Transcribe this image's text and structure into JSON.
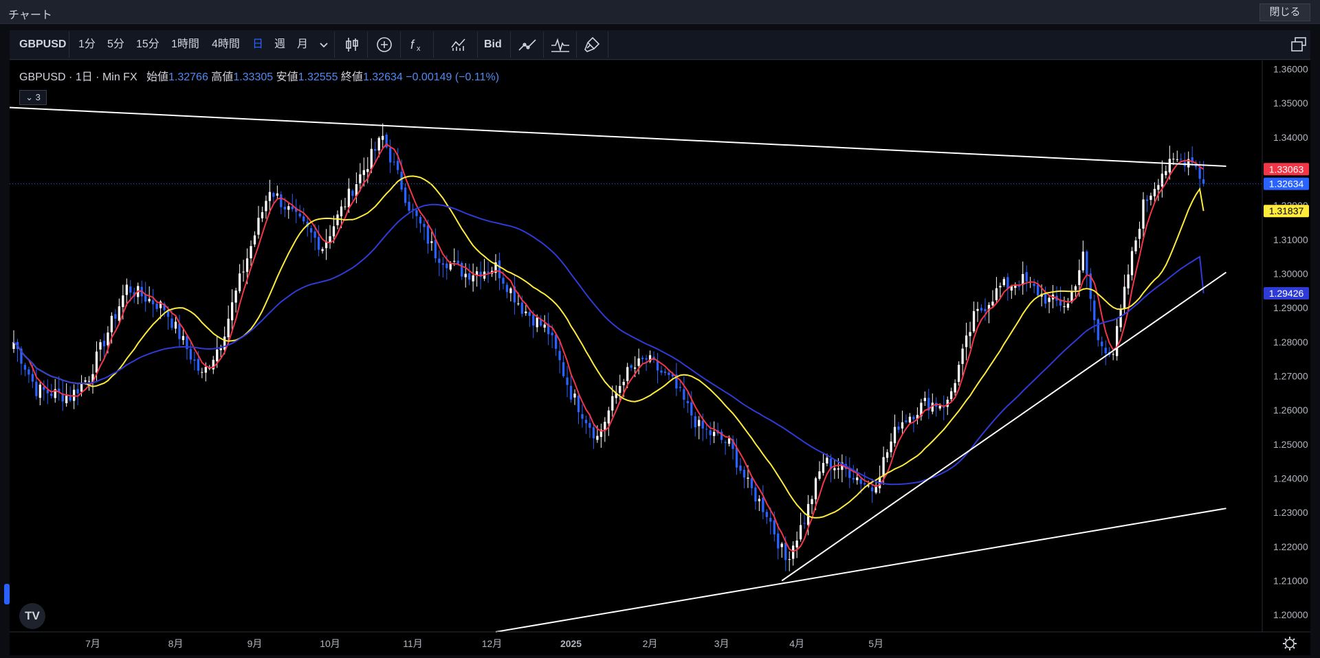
{
  "window": {
    "title": "チャート",
    "close_label": "閉じる"
  },
  "toolbar": {
    "symbol": "GBPUSD",
    "intervals": [
      "1分",
      "5分",
      "15分",
      "1時間",
      "4時間",
      "日",
      "週",
      "月"
    ],
    "active_interval": "日",
    "bid_label": "Bid"
  },
  "legend": {
    "symbol": "GBPUSD",
    "interval": "1日",
    "source": "Min FX",
    "open_label": "始値",
    "open": "1.32766",
    "high_label": "高値",
    "high": "1.33305",
    "low_label": "安値",
    "low": "1.32555",
    "close_label": "終値",
    "close": "1.32634",
    "change": "−0.00149 (−0.11%)",
    "collapse_count": "3"
  },
  "colors": {
    "up": "#ffffff",
    "down": "#2962ff",
    "ma_fast": "#f23645",
    "ma_mid": "#ffeb3b",
    "ma_slow": "#2f3bd6",
    "trendline": "#ffffff"
  },
  "chart_data": {
    "type": "candlestick",
    "y_range": [
      1.195,
      1.3625
    ],
    "y_ticks": [
      "1.36000",
      "1.35000",
      "1.34000",
      "1.33000",
      "1.32000",
      "1.31000",
      "1.30000",
      "1.29000",
      "1.28000",
      "1.27000",
      "1.26000",
      "1.25000",
      "1.24000",
      "1.23000",
      "1.22000",
      "1.21000",
      "1.20000"
    ],
    "x_ticks": [
      "7月",
      "8月",
      "9月",
      "10月",
      "11月",
      "12月",
      "2025",
      "2月",
      "3月",
      "4月",
      "5月"
    ],
    "anchors": [
      [
        0,
        1.28
      ],
      [
        6,
        1.266
      ],
      [
        15,
        1.264
      ],
      [
        20,
        1.27
      ],
      [
        30,
        1.296
      ],
      [
        40,
        1.29
      ],
      [
        45,
        1.28
      ],
      [
        50,
        1.27
      ],
      [
        55,
        1.28
      ],
      [
        60,
        1.298
      ],
      [
        68,
        1.325
      ],
      [
        75,
        1.316
      ],
      [
        82,
        1.308
      ],
      [
        90,
        1.325
      ],
      [
        98,
        1.34
      ],
      [
        105,
        1.32
      ],
      [
        112,
        1.306
      ],
      [
        120,
        1.3
      ],
      [
        128,
        1.302
      ],
      [
        135,
        1.29
      ],
      [
        142,
        1.283
      ],
      [
        148,
        1.265
      ],
      [
        155,
        1.252
      ],
      [
        162,
        1.27
      ],
      [
        168,
        1.275
      ],
      [
        175,
        1.268
      ],
      [
        182,
        1.255
      ],
      [
        190,
        1.25
      ],
      [
        195,
        1.238
      ],
      [
        200,
        1.23
      ],
      [
        205,
        1.216
      ],
      [
        210,
        1.228
      ],
      [
        215,
        1.245
      ],
      [
        222,
        1.242
      ],
      [
        228,
        1.237
      ],
      [
        235,
        1.256
      ],
      [
        242,
        1.262
      ],
      [
        248,
        1.262
      ],
      [
        255,
        1.287
      ],
      [
        262,
        1.296
      ],
      [
        268,
        1.298
      ],
      [
        275,
        1.292
      ],
      [
        280,
        1.291
      ],
      [
        284,
        1.305
      ],
      [
        288,
        1.28
      ],
      [
        292,
        1.277
      ],
      [
        296,
        1.3
      ],
      [
        300,
        1.32
      ],
      [
        305,
        1.33
      ],
      [
        309,
        1.333
      ],
      [
        313,
        1.334
      ],
      [
        316,
        1.326
      ]
    ],
    "last_candle": {
      "open": 1.32766,
      "high": 1.33305,
      "low": 1.32555,
      "close": 1.32634
    },
    "moving_averages": [
      {
        "period": 5,
        "color": "#f23645",
        "last": "1.33063"
      },
      {
        "period": 20,
        "color": "#ffeb3b",
        "last": "1.31837"
      },
      {
        "period": 50,
        "color": "#2f3bd6",
        "last": "1.29426"
      }
    ],
    "price_tags": [
      {
        "value": 1.33063,
        "text": "1.33063",
        "color": "#f23645"
      },
      {
        "value": 1.32634,
        "text": "1.32634",
        "color": "#2962ff"
      },
      {
        "value": 1.31837,
        "text": "1.31837",
        "color": "#ffeb3b"
      },
      {
        "value": 1.29426,
        "text": "1.29426",
        "color": "#2f3bd6"
      }
    ],
    "current_price": 1.32634,
    "trendlines": [
      {
        "from": [
          -2,
          1.3487
        ],
        "to": [
          322,
          1.3315
        ]
      },
      {
        "from": [
          204,
          1.21
        ],
        "to": [
          322,
          1.3004
        ]
      },
      {
        "from": [
          128,
          1.195
        ],
        "to": [
          322,
          1.2312
        ]
      }
    ],
    "grid": false
  }
}
